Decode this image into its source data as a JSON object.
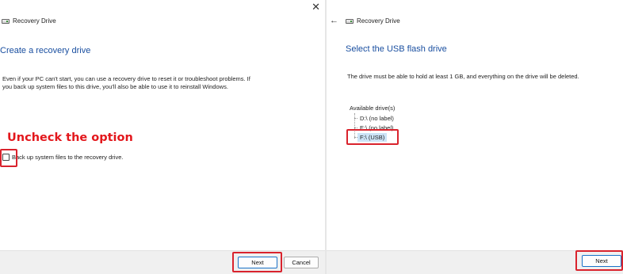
{
  "left": {
    "window_title": "Recovery Drive",
    "close_glyph": "✕",
    "heading": "Create a recovery drive",
    "body_line1": "Even if your PC can't start, you can use a recovery drive to reset it or troubleshoot problems. If",
    "body_line2": "you back up system files to this drive, you'll also be able to use it to reinstall Windows.",
    "annotation": "Uncheck the option",
    "checkbox_label": "Back up system files to the recovery drive.",
    "checkbox_checked": false,
    "next_label": "Next",
    "cancel_label": "Cancel"
  },
  "right": {
    "back_glyph": "←",
    "window_title": "Recovery Drive",
    "heading": "Select the USB flash drive",
    "body": "The drive must be able to hold at least 1 GB, and everything on the drive will be deleted.",
    "drives_label": "Available drive(s)",
    "drives": [
      "D:\\ (no label)",
      "E:\\ (no label)",
      "F:\\ (USB)"
    ],
    "selected_drive": "F:\\ (USB)",
    "next_label": "Next"
  },
  "icons": {
    "drive": "drive-icon",
    "close": "close-icon",
    "back": "back-arrow-icon"
  },
  "colors": {
    "heading_blue": "#1a4fa0",
    "annotation_red": "#e3171c",
    "selection_blue": "#cce4f7"
  }
}
